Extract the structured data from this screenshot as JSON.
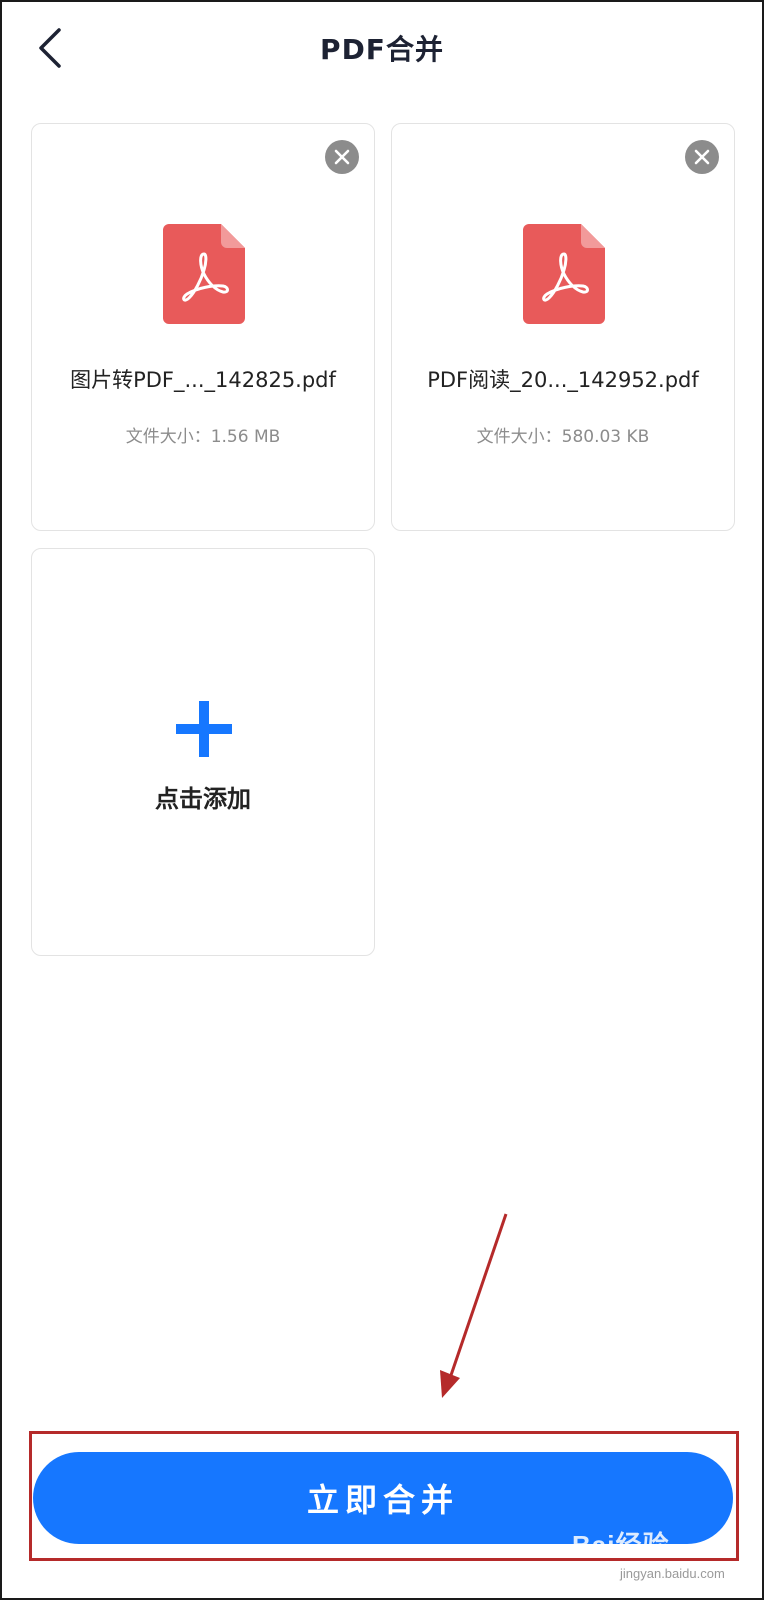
{
  "header": {
    "title": "PDF合并",
    "back_icon": "chevron-left-icon"
  },
  "files": [
    {
      "name": "图片转PDF_..._142825.pdf",
      "size": "文件大小：1.56 MB",
      "icon": "pdf-file-icon"
    },
    {
      "name": "PDF阅读_20..._142952.pdf",
      "size": "文件大小：580.03 KB",
      "icon": "pdf-file-icon"
    }
  ],
  "add_card": {
    "label": "点击添加",
    "icon": "plus-icon"
  },
  "merge_button": {
    "label": "立即合并"
  },
  "watermark": {
    "text": "Bai经验",
    "url": "jingyan.baidu.com"
  },
  "colors": {
    "accent": "#1677ff",
    "pdf_red": "#e85a5a",
    "annotation_red": "#b52a2a",
    "remove_gray": "#8c8c8c"
  }
}
